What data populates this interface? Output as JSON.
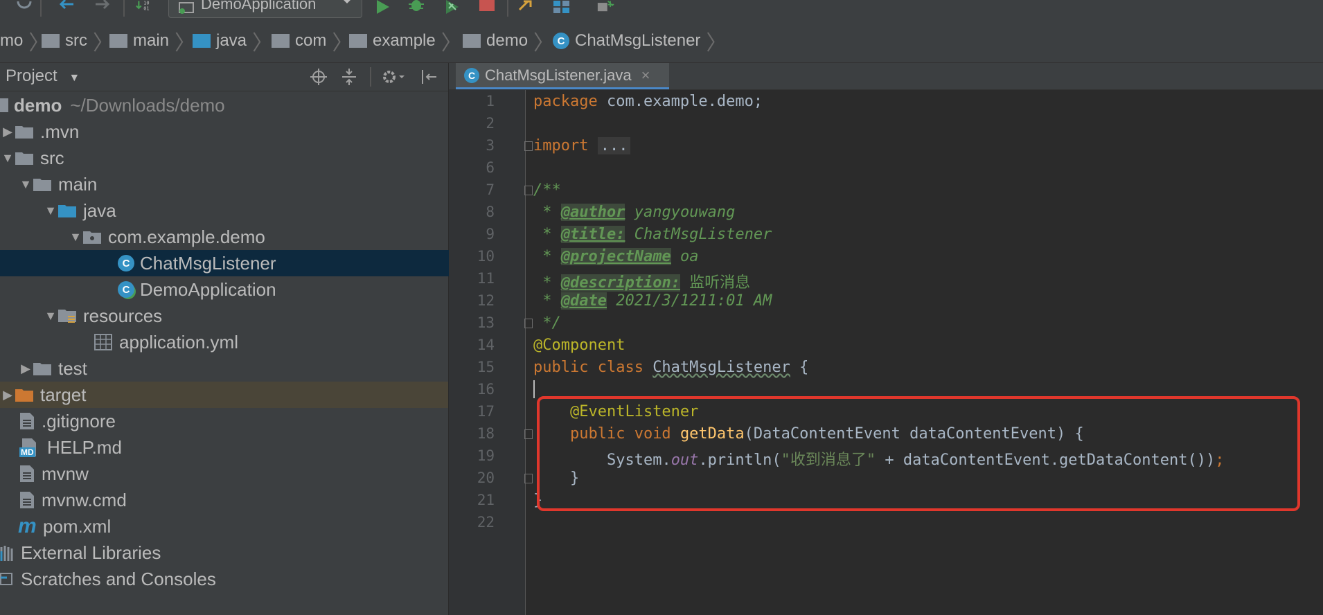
{
  "toolbar": {
    "run_config": "DemoApplication",
    "icons": [
      "sync-icon",
      "back-icon",
      "forward-icon",
      "sort-icon",
      "run-icon",
      "debug-icon",
      "coverage-icon",
      "stop-icon",
      "build-icon",
      "structure-icon",
      "sdk-icon"
    ],
    "colors": {
      "run": "#499c54",
      "stop": "#c75450",
      "accent": "#3592c4"
    }
  },
  "breadcrumb": {
    "items": [
      "mo",
      "src",
      "main",
      "java",
      "com",
      "example",
      "demo",
      "ChatMsgListener"
    ]
  },
  "project_panel": {
    "title": "Project",
    "tree": [
      {
        "label": "demo",
        "extra": "~/Downloads/demo"
      },
      {
        "label": ".mvn"
      },
      {
        "label": "src"
      },
      {
        "label": "main"
      },
      {
        "label": "java"
      },
      {
        "label": "com.example.demo"
      },
      {
        "label": "ChatMsgListener"
      },
      {
        "label": "DemoApplication"
      },
      {
        "label": "resources"
      },
      {
        "label": "application.yml"
      },
      {
        "label": "test"
      },
      {
        "label": "target"
      },
      {
        "label": ".gitignore"
      },
      {
        "label": "HELP.md"
      },
      {
        "label": "mvnw"
      },
      {
        "label": "mvnw.cmd"
      },
      {
        "label": "pom.xml"
      },
      {
        "label": "External Libraries"
      },
      {
        "label": "Scratches and Consoles"
      }
    ],
    "md_badge": "MD",
    "maven_glyph": "m"
  },
  "editor": {
    "tab_label": "ChatMsgListener.java",
    "tab_close": "×",
    "line_numbers": [
      "1",
      "2",
      "3",
      "6",
      "7",
      "8",
      "9",
      "10",
      "11",
      "12",
      "13",
      "14",
      "15",
      "16",
      "17",
      "18",
      "19",
      "20",
      "21",
      "22"
    ],
    "code": {
      "package_kw": "package",
      "package_name": " com.example.demo;",
      "import_kw": "import",
      "import_folded": "...",
      "doc_open": "/**",
      "author_tag": "@author",
      "author_val": " yangyouwang",
      "title_tag": "@title:",
      "title_val": " ChatMsgListener",
      "project_tag": "@projectName",
      "project_val": " oa",
      "desc_tag": "@description:",
      "desc_val": " 监听消息",
      "date_tag": "@date",
      "date_val": " 2021/3/1211:01 AM",
      "doc_close": " */",
      "component_ann": "@Component",
      "class_kw": "public class ",
      "class_name": "ChatMsgListener",
      "class_brace": " {",
      "listener_ann": "@EventListener",
      "method_kw": "public void ",
      "method_name": "getData",
      "method_params": "(DataContentEvent dataContentEvent) {",
      "sys": "System.",
      "out": "out",
      "println": ".println(",
      "str_literal": "\"收到消息了\"",
      "concat": " + dataContentEvent.getDataContent())",
      "semi": ";",
      "close_brace": "}",
      "last_brace": "}"
    }
  }
}
